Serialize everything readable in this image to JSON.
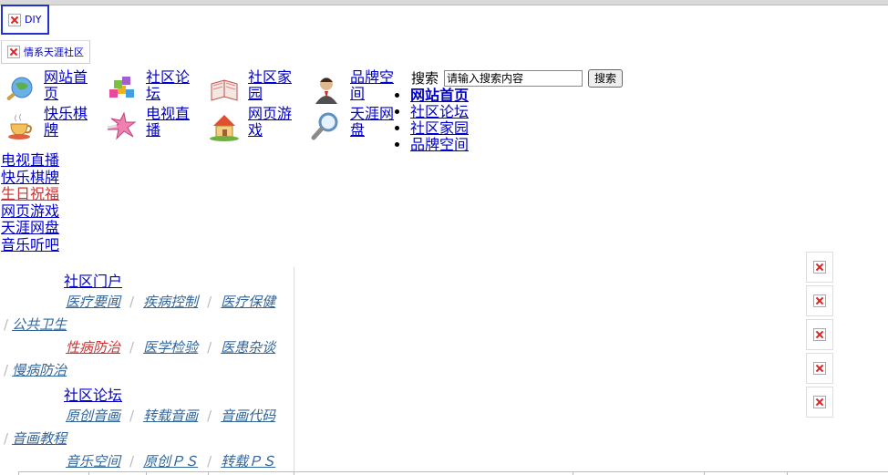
{
  "header": {
    "diy_label": "DIY",
    "community_logo_label": "情系天涯社区"
  },
  "nav": {
    "items": [
      {
        "label": "网站首页",
        "icon": "globe-search-icon"
      },
      {
        "label": "社区论坛",
        "icon": "blocks-icon"
      },
      {
        "label": "社区家园",
        "icon": "book-icon"
      },
      {
        "label": "品牌空间",
        "icon": "person-icon"
      },
      {
        "label": "快乐棋牌",
        "icon": "teacup-icon"
      },
      {
        "label": "电视直播",
        "icon": "star-icon"
      },
      {
        "label": "网页游戏",
        "icon": "house-icon"
      },
      {
        "label": "天涯网盘",
        "icon": "magnifier-icon"
      }
    ]
  },
  "search": {
    "label": "搜索",
    "placeholder": "请输入搜索内容",
    "button_label": "搜索"
  },
  "bullet_links": [
    "网站首页",
    "社区论坛",
    "社区家园",
    "品牌空间"
  ],
  "side_links": [
    "电视直播",
    "快乐棋牌",
    "生日祝福",
    "网页游戏",
    "天涯网盘",
    "音乐听吧"
  ],
  "portal": {
    "section1_title": "社区门户",
    "section1_links": [
      "医疗要闻",
      "疾病控制",
      "医疗保健",
      "公共卫生",
      "性病防治",
      "医学检验",
      "医患杂谈",
      "慢病防治"
    ],
    "section2_title": "社区论坛",
    "section2_links": [
      "原创音画",
      "转载音画",
      "音画代码",
      "音画教程",
      "音乐空间",
      "原创ＰＳ",
      "转载ＰＳ"
    ]
  },
  "colors": {
    "link": "#0000cc",
    "link_red": "#cc3333",
    "portal_link": "#336699",
    "diy_border": "#2233cc"
  }
}
